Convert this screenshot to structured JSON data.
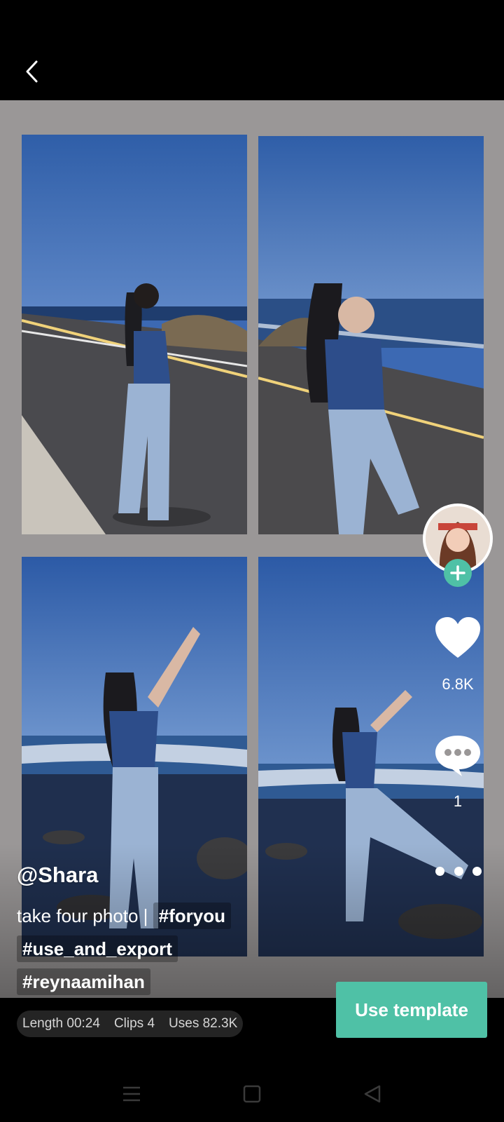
{
  "header": {
    "back_icon": "chevron-left-icon"
  },
  "creator": {
    "handle": "@Shara",
    "avatar_icon": "avatar",
    "follow_icon": "plus-icon"
  },
  "actions": {
    "like_icon": "heart-icon",
    "like_count": "6.8K",
    "comment_icon": "chat-bubble-icon",
    "comment_count": "1",
    "more_icon": "more-dots-icon"
  },
  "caption": {
    "text": "take four photo |",
    "hashtags": [
      "#foryou",
      "#use_and_export",
      "#reynaamihan"
    ]
  },
  "template_info": {
    "length": "Length 00:24",
    "clips": "Clips 4",
    "uses": "Uses 82.3K"
  },
  "use_template_label": "Use template",
  "colors": {
    "accent": "#4fc1a6",
    "preview_background": "#9a9797",
    "sky": "#3c69b3"
  },
  "system_nav": {
    "menu_icon": "menu-icon",
    "home_icon": "square-icon",
    "back_icon": "triangle-back-icon"
  }
}
